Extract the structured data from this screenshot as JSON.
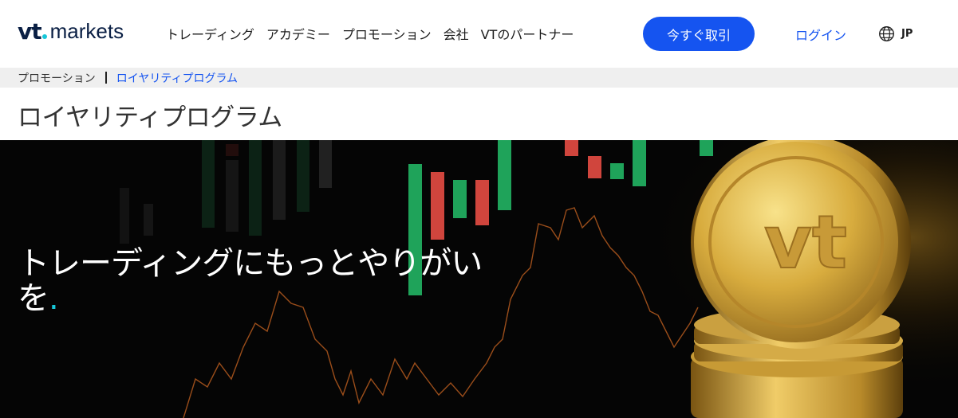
{
  "header": {
    "logo": {
      "mark": "vt",
      "word": "markets"
    },
    "nav": [
      {
        "label": "トレーディング"
      },
      {
        "label": "アカデミー"
      },
      {
        "label": "プロモーション"
      },
      {
        "label": "会社"
      },
      {
        "label": "VTのパートナー"
      }
    ],
    "cta_label": "今すぐ取引",
    "login_label": "ログイン",
    "language": "JP",
    "language_icon": "globe-icon"
  },
  "breadcrumb": {
    "items": [
      "プロモーション",
      "ロイヤリティプログラム"
    ]
  },
  "page": {
    "title": "ロイヤリティプログラム"
  },
  "hero": {
    "headline_line1": "トレーディングにもっとやりがい",
    "headline_line2": "を",
    "accent_mark": ".",
    "coin_mark": "vt"
  },
  "colors": {
    "brand_blue": "#1554f0",
    "accent_cyan": "#17c7d8",
    "candle_green": "#1fa35a",
    "candle_red": "#d0453d",
    "gold": "#d7b04a"
  }
}
